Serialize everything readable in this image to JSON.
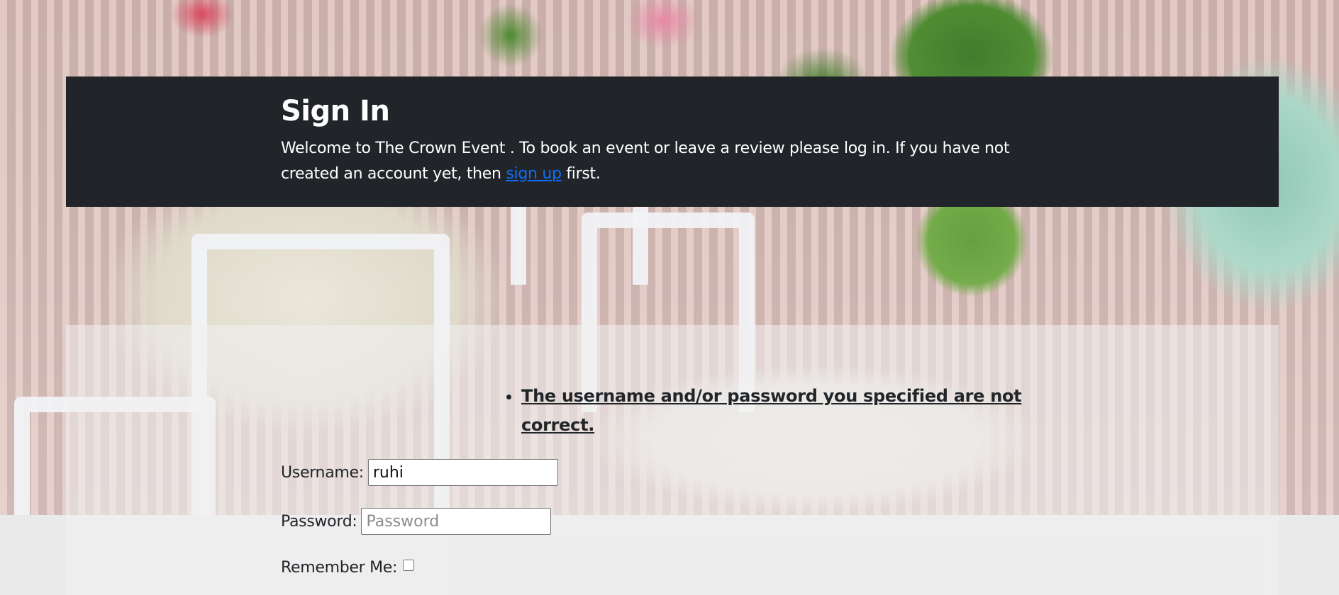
{
  "header": {
    "title": "Sign In",
    "welcome_text_before_link": "Welcome to The Crown Event . To book an event or leave a review please log in. If you have not created an account yet, then ",
    "signup_link": "sign up",
    "welcome_text_after_link": " first."
  },
  "form": {
    "errors": [
      "The username and/or password you specified are not correct."
    ],
    "username_label": "Username:",
    "username_value": "ruhi",
    "password_label": "Password:",
    "password_placeholder": "Password",
    "remember_label": "Remember Me:"
  },
  "colors": {
    "header_bg": "#212529",
    "link": "#0d6efd",
    "text": "#212529"
  }
}
